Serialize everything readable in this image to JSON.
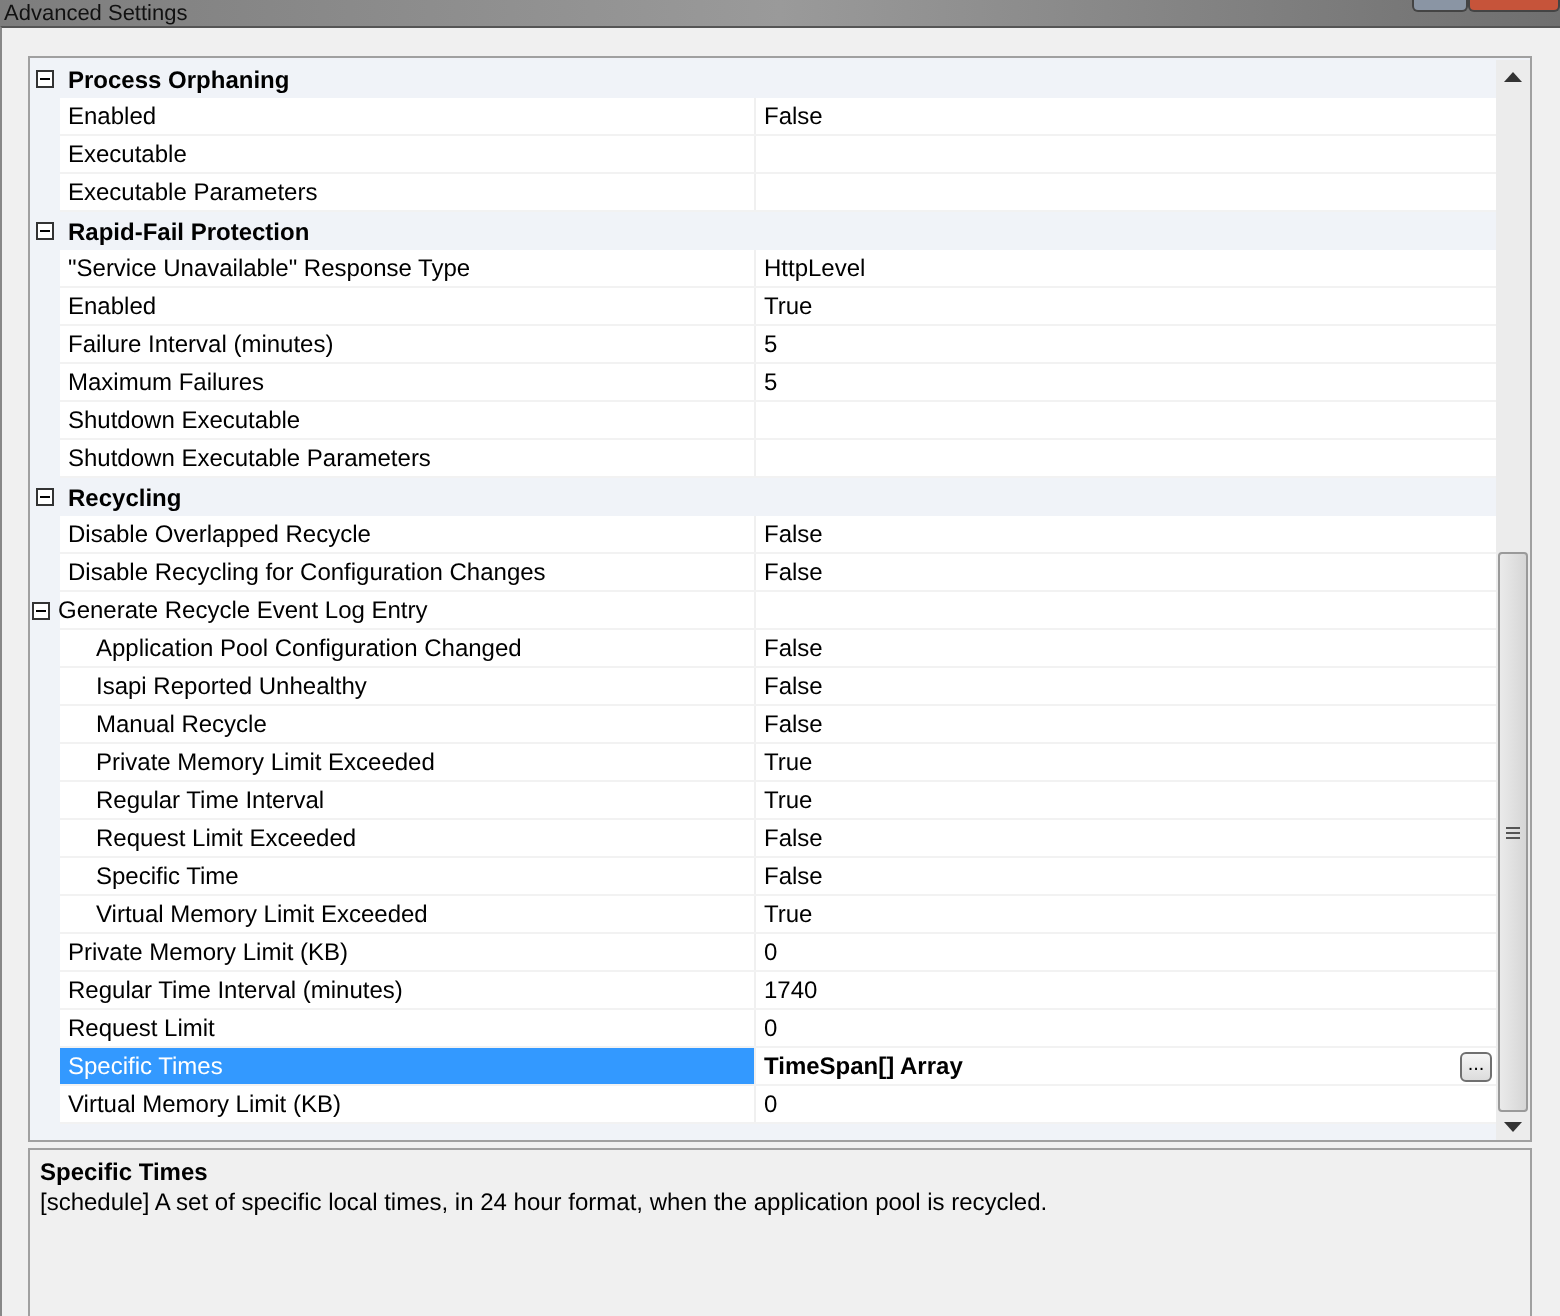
{
  "window": {
    "title": "Advanced Settings"
  },
  "grid": {
    "categories": [
      {
        "name": "Process Orphaning",
        "expanded": true,
        "properties": [
          {
            "name": "Enabled",
            "value": "False",
            "selected": false
          },
          {
            "name": "Executable",
            "selected": false
          },
          {
            "name": "Executable Parameters",
            "selected": false
          }
        ]
      },
      {
        "name": "Rapid-Fail Protection",
        "expanded": true,
        "properties": [
          {
            "name": "\"Service Unavailable\" Response Type",
            "value": "HttpLevel",
            "selected": false
          },
          {
            "name": "Enabled",
            "value": "True",
            "selected": false
          },
          {
            "name": "Failure Interval (minutes)",
            "value": "5",
            "selected": false
          },
          {
            "name": "Maximum Failures",
            "value": "5",
            "selected": false
          },
          {
            "name": "Shutdown Executable",
            "selected": false
          },
          {
            "name": "Shutdown Executable Parameters",
            "selected": false
          }
        ]
      },
      {
        "name": "Recycling",
        "expanded": true,
        "properties": [
          {
            "name": "Disable Overlapped Recycle",
            "value": "False",
            "selected": false
          },
          {
            "name": "Disable Recycling for Configuration Changes",
            "value": "False",
            "selected": false
          },
          {
            "name": "Generate Recycle Event Log Entry",
            "selected": false,
            "expanded": true,
            "children": [
              {
                "name": "Application Pool Configuration Changed",
                "value": "False",
                "selected": false
              },
              {
                "name": "Isapi Reported Unhealthy",
                "value": "False",
                "selected": false
              },
              {
                "name": "Manual Recycle",
                "value": "False",
                "selected": false
              },
              {
                "name": "Private Memory Limit Exceeded",
                "value": "True",
                "selected": false
              },
              {
                "name": "Regular Time Interval",
                "value": "True",
                "selected": false
              },
              {
                "name": "Request Limit Exceeded",
                "value": "False",
                "selected": false
              },
              {
                "name": "Specific Time",
                "value": "False",
                "selected": false
              },
              {
                "name": "Virtual Memory Limit Exceeded",
                "value": "True",
                "selected": false
              }
            ]
          },
          {
            "name": "Private Memory Limit (KB)",
            "value": "0",
            "selected": false
          },
          {
            "name": "Regular Time Interval (minutes)",
            "value": "1740",
            "selected": false
          },
          {
            "name": "Request Limit",
            "value": "0",
            "selected": false
          },
          {
            "name": "Specific Times",
            "value": "TimeSpan[] Array",
            "selected": true,
            "editor_button": "..."
          },
          {
            "name": "Virtual Memory Limit (KB)",
            "value": "0",
            "selected": false
          }
        ]
      }
    ]
  },
  "description": {
    "title": "Specific Times",
    "text": "[schedule] A set of specific local times, in 24 hour format, when the application pool is recycled."
  }
}
